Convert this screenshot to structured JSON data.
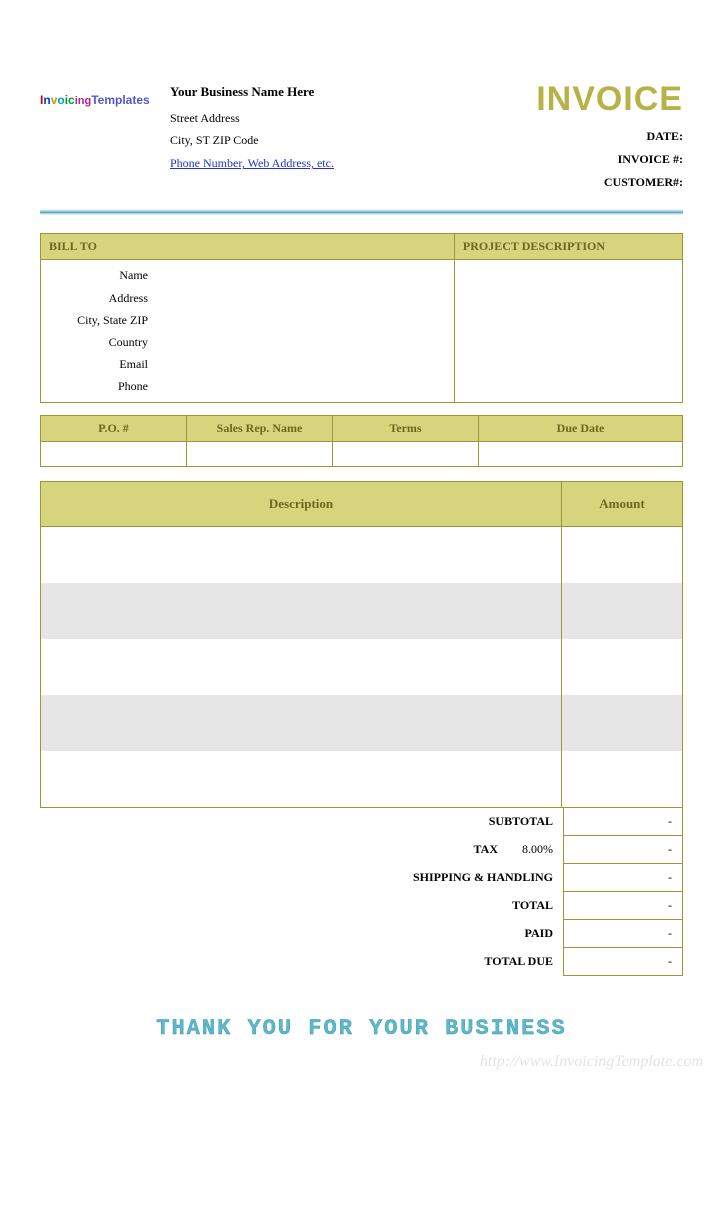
{
  "header": {
    "logo_text": "InvoicingTemplates",
    "business_name": "Your Business Name Here",
    "street": "Street Address",
    "city_line": "City, ST  ZIP Code",
    "contact_link": "Phone Number, Web Address, etc.",
    "invoice_title": "INVOICE",
    "meta": {
      "date_label": "DATE:",
      "invoice_no_label": "INVOICE #:",
      "customer_no_label": "CUSTOMER#:"
    }
  },
  "bill_to": {
    "heading": "BILL TO",
    "labels": {
      "name": "Name",
      "address": "Address",
      "city": "City, State ZIP",
      "country": "Country",
      "email": "Email",
      "phone": "Phone"
    }
  },
  "project": {
    "heading": "PROJECT DESCRIPTION"
  },
  "po_row": {
    "po": "P.O. #",
    "rep": "Sales Rep. Name",
    "terms": "Terms",
    "due": "Due Date"
  },
  "items": {
    "desc_header": "Description",
    "amount_header": "Amount"
  },
  "totals": {
    "subtotal_label": "SUBTOTAL",
    "tax_label": "TAX",
    "tax_rate": "8.00%",
    "shipping_label": "SHIPPING & HANDLING",
    "total_label": "TOTAL",
    "paid_label": "PAID",
    "due_label": "TOTAL DUE",
    "placeholder": "-"
  },
  "footer": {
    "thanks": "THANK YOU FOR YOUR BUSINESS",
    "watermark": "http://www.InvoicingTemplate.com"
  }
}
